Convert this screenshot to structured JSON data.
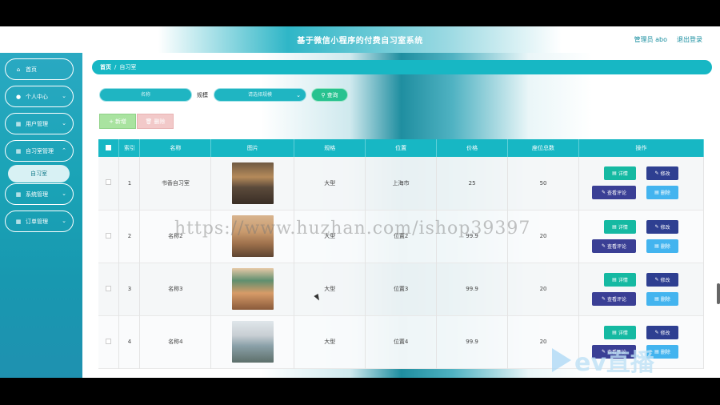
{
  "header": {
    "title": "基于微信小程序的付费自习室系统",
    "user": "管理员 abo",
    "logout": "退出登录"
  },
  "sidebar": {
    "items": [
      {
        "label": "首页",
        "icon": "home-icon",
        "has_chevron": false
      },
      {
        "label": "个人中心",
        "icon": "user-icon",
        "has_chevron": true
      },
      {
        "label": "用户管理",
        "icon": "grid-icon",
        "has_chevron": true
      },
      {
        "label": "自习室管理",
        "icon": "grid-icon",
        "has_chevron": true
      },
      {
        "label": "系统管理",
        "icon": "grid-icon",
        "has_chevron": true
      },
      {
        "label": "订单管理",
        "icon": "grid-icon",
        "has_chevron": true
      }
    ],
    "sub_item": "自习室"
  },
  "breadcrumb": {
    "home": "首页",
    "sep": "/",
    "current": "自习室"
  },
  "filters": {
    "name_placeholder": "名称",
    "scale_label": "规模",
    "scale_placeholder": "请选择规模",
    "query": "查询"
  },
  "actions": {
    "add": "新增",
    "delete": "删除"
  },
  "table": {
    "headers": [
      "索引",
      "名称",
      "图片",
      "规格",
      "位置",
      "价格",
      "座位总数",
      "操作"
    ],
    "rows": [
      {
        "index": "1",
        "name": "书香自习室",
        "scale": "大型",
        "location": "上海市",
        "price": "25",
        "seats": "50"
      },
      {
        "index": "2",
        "name": "名称2",
        "scale": "大型",
        "location": "位置2",
        "price": "99.9",
        "seats": "20"
      },
      {
        "index": "3",
        "name": "名称3",
        "scale": "大型",
        "location": "位置3",
        "price": "99.9",
        "seats": "20"
      },
      {
        "index": "4",
        "name": "名称4",
        "scale": "大型",
        "location": "位置4",
        "price": "99.9",
        "seats": "20"
      }
    ],
    "ops": {
      "detail": "详情",
      "edit": "修改",
      "review": "查看评论",
      "delete": "删除"
    }
  },
  "overlay": {
    "watermark": "https://www.huzhan.com/ishop39397",
    "brand": "ev直播"
  },
  "colors": {
    "accent": "#17b7c4",
    "detail": "#15b9a2",
    "edit": "#2e3f91",
    "delete": "#43b4ef"
  }
}
